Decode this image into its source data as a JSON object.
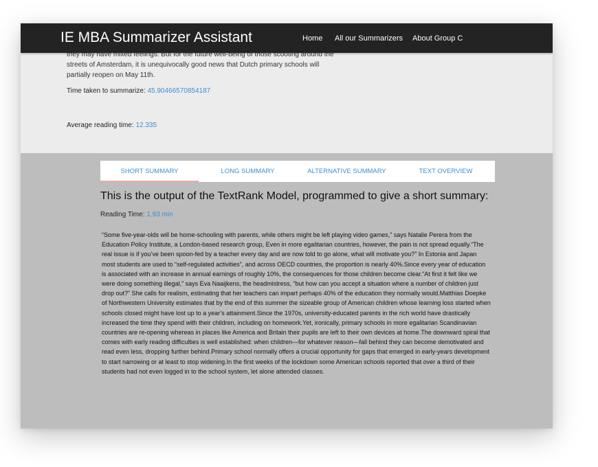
{
  "navbar": {
    "brand": "IE MBA Summarizer Assistant",
    "links": [
      "Home",
      "All our Summarizers",
      "About Group C"
    ]
  },
  "top": {
    "text_snippet": "they may have mixed feelings. But for the future well-being of those scooting around the streets of Amsterdam, it is unequivocally good news that Dutch primary schools will partially reopen on May 11th.",
    "time_label": "Time taken to summarize: ",
    "time_value": "45.90466570854187",
    "avg_label": "Average reading time: ",
    "avg_value": "12.335"
  },
  "tabs": [
    "SHORT SUMMARY",
    "LONG SUMMARY",
    "ALTERNATIVE SUMMARY",
    "TEXT OVERVIEW"
  ],
  "result": {
    "title": "This is the output of the TextRank Model, programmed to give a short summary:",
    "reading_label": "Reading Time: ",
    "reading_value": "1.93 min",
    "summary": "“Some five-year-olds will be home-schooling with parents, while others might be left playing video games,” says Natalie Perera from the Education Policy Institute, a London-based research group, Even in more egalitarian countries, however, the pain is not spread equally.“The real issue is if you’ve been spoon-fed by a teacher every day and are now told to go alone, what will motivate you?” In Estonia and Japan most students are used to “self-regulated activities”, and across OECD countries, the proportion is nearly 40%.Since every year of education is associated with an increase in annual earnings of roughly 10%, the consequences for those children become clear.“At first it felt like we were doing something illegal,” says Eva Naaijkens, the headmistress, “but how can you accept a situation where a number of children just drop out?” She calls for realism, estimating that her teachers can impart perhaps 40% of the education they normally would.Matthias Doepke of Northwestern University estimates that by the end of this summer the sizeable group of American children whose learning loss started when schools closed might have lost up to a year’s attainment.Since the 1970s, university-educated parents in the rich world have drastically increased the time they spend with their children, including on homework.Yet, ironically, primary schools in more egalitarian Scandinavian countries are re-opening whereas in places like America and Britain their pupils are left to their own devices at home.The downward spiral that comes with early reading difficulties is well established: when children—for whatever reason—fall behind they can become demotivated and read even less, dropping further behind.Primary school normally offers a crucial opportunity for gaps that emerged in early-years development to start narrowing or at least to stop widening.In the first weeks of the lockdown some American schools reported that over a third of their students had not even logged in to the school system, let alone attended classes."
  }
}
